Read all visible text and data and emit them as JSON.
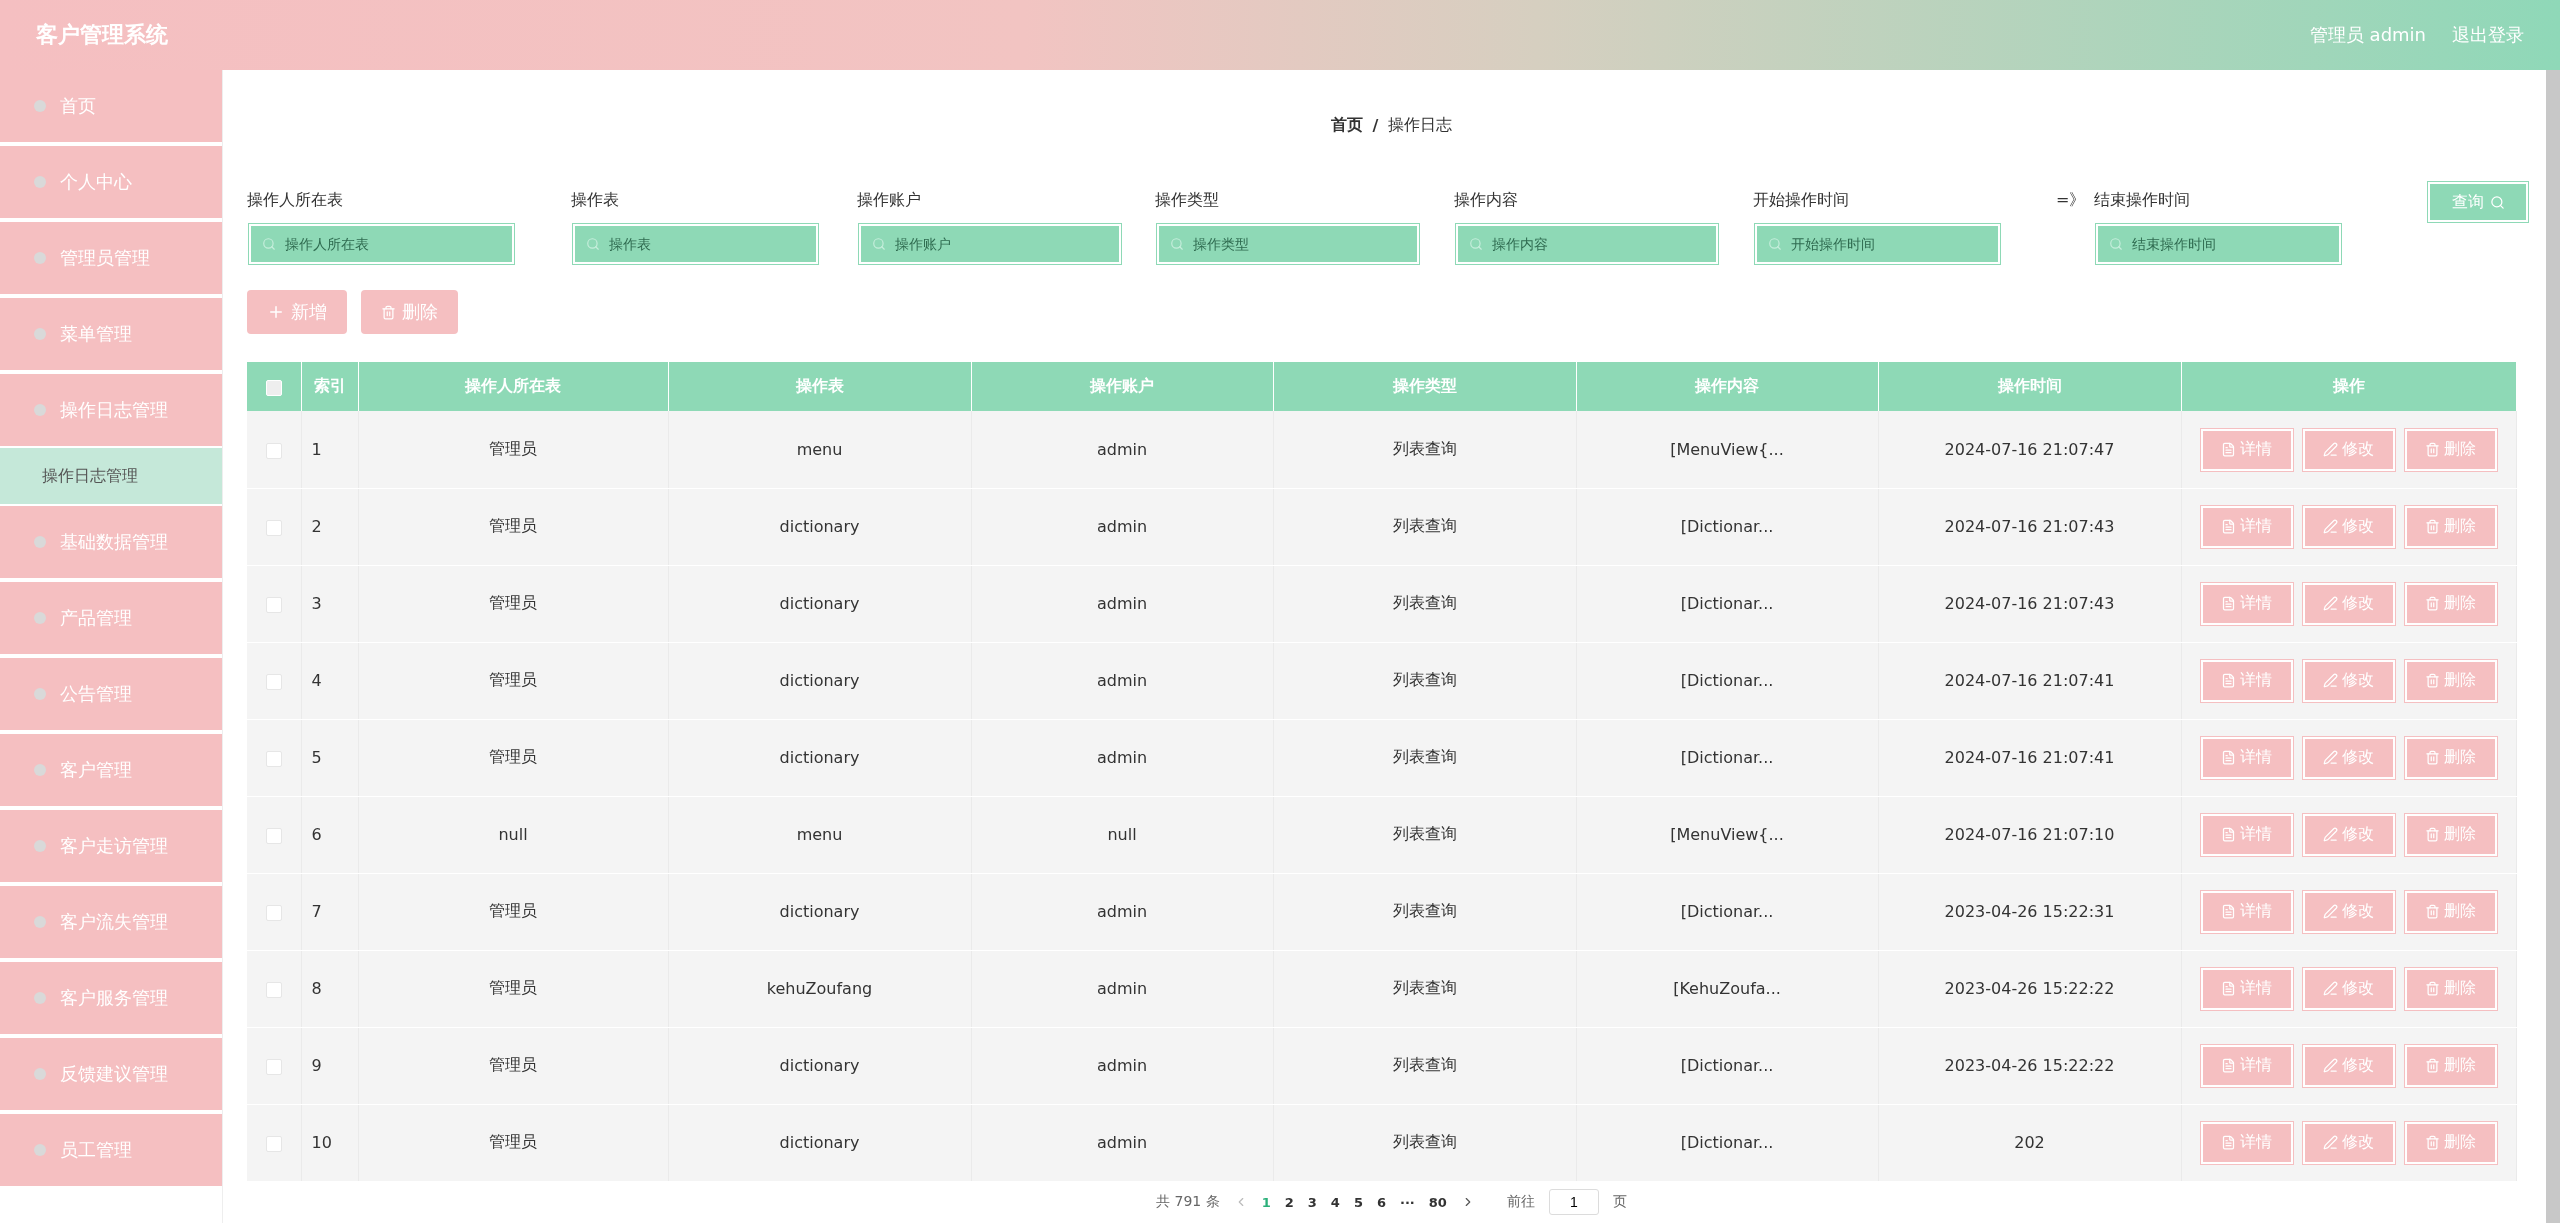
{
  "header": {
    "title": "客户管理系统",
    "user": "管理员 admin",
    "logout": "退出登录"
  },
  "sidebar": {
    "items": [
      {
        "label": "首页"
      },
      {
        "label": "个人中心"
      },
      {
        "label": "管理员管理"
      },
      {
        "label": "菜单管理"
      },
      {
        "label": "操作日志管理",
        "children": [
          {
            "label": "操作日志管理",
            "selected": true
          }
        ]
      },
      {
        "label": "基础数据管理"
      },
      {
        "label": "产品管理"
      },
      {
        "label": "公告管理"
      },
      {
        "label": "客户管理"
      },
      {
        "label": "客户走访管理"
      },
      {
        "label": "客户流失管理"
      },
      {
        "label": "客户服务管理"
      },
      {
        "label": "反馈建议管理"
      },
      {
        "label": "员工管理"
      }
    ]
  },
  "breadcrumb": [
    "首页",
    "操作日志"
  ],
  "breadcrumb_separator": "/",
  "filters": [
    {
      "label": "操作人所在表",
      "placeholder": "操作人所在表"
    },
    {
      "label": "操作表",
      "placeholder": "操作表"
    },
    {
      "label": "操作账户",
      "placeholder": "操作账户"
    },
    {
      "label": "操作类型",
      "placeholder": "操作类型"
    },
    {
      "label": "操作内容",
      "placeholder": "操作内容"
    },
    {
      "label": "开始操作时间",
      "placeholder": "开始操作时间"
    }
  ],
  "range_separator": "=》",
  "end_filter": {
    "label": "结束操作时间",
    "placeholder": "结束操作时间"
  },
  "query_button": "查询",
  "toolbar": [
    {
      "label": "新增",
      "kind": "add"
    },
    {
      "label": "删除",
      "kind": "delete"
    }
  ],
  "table": {
    "header_checked": false,
    "columns": [
      "索引",
      "操作人所在表",
      "操作表",
      "操作账户",
      "操作类型",
      "操作内容",
      "操作时间",
      "操作"
    ],
    "rows": [
      {
        "checked": false,
        "cells": [
          "1",
          "管理员",
          "menu",
          "admin",
          "列表查询",
          "[MenuView{...",
          "2024-07-16 21:07:47"
        ],
        "actions": [
          {
            "label": "详情",
            "kind": "detail"
          },
          {
            "label": "修改",
            "kind": "edit"
          },
          {
            "label": "删除",
            "kind": "delete"
          }
        ]
      },
      {
        "checked": false,
        "cells": [
          "2",
          "管理员",
          "dictionary",
          "admin",
          "列表查询",
          "[Dictionar...",
          "2024-07-16 21:07:43"
        ],
        "actions": [
          {
            "label": "详情",
            "kind": "detail"
          },
          {
            "label": "修改",
            "kind": "edit"
          },
          {
            "label": "删除",
            "kind": "delete"
          }
        ]
      },
      {
        "checked": false,
        "cells": [
          "3",
          "管理员",
          "dictionary",
          "admin",
          "列表查询",
          "[Dictionar...",
          "2024-07-16 21:07:43"
        ],
        "actions": [
          {
            "label": "详情",
            "kind": "detail"
          },
          {
            "label": "修改",
            "kind": "edit"
          },
          {
            "label": "删除",
            "kind": "delete"
          }
        ]
      },
      {
        "checked": false,
        "cells": [
          "4",
          "管理员",
          "dictionary",
          "admin",
          "列表查询",
          "[Dictionar...",
          "2024-07-16 21:07:41"
        ],
        "actions": [
          {
            "label": "详情",
            "kind": "detail"
          },
          {
            "label": "修改",
            "kind": "edit"
          },
          {
            "label": "删除",
            "kind": "delete"
          }
        ]
      },
      {
        "checked": false,
        "cells": [
          "5",
          "管理员",
          "dictionary",
          "admin",
          "列表查询",
          "[Dictionar...",
          "2024-07-16 21:07:41"
        ],
        "actions": [
          {
            "label": "详情",
            "kind": "detail"
          },
          {
            "label": "修改",
            "kind": "edit"
          },
          {
            "label": "删除",
            "kind": "delete"
          }
        ]
      },
      {
        "checked": false,
        "cells": [
          "6",
          "null",
          "menu",
          "null",
          "列表查询",
          "[MenuView{...",
          "2024-07-16 21:07:10"
        ],
        "actions": [
          {
            "label": "详情",
            "kind": "detail"
          },
          {
            "label": "修改",
            "kind": "edit"
          },
          {
            "label": "删除",
            "kind": "delete"
          }
        ]
      },
      {
        "checked": false,
        "cells": [
          "7",
          "管理员",
          "dictionary",
          "admin",
          "列表查询",
          "[Dictionar...",
          "2023-04-26 15:22:31"
        ],
        "actions": [
          {
            "label": "详情",
            "kind": "detail"
          },
          {
            "label": "修改",
            "kind": "edit"
          },
          {
            "label": "删除",
            "kind": "delete"
          }
        ]
      },
      {
        "checked": false,
        "cells": [
          "8",
          "管理员",
          "kehuZoufang",
          "admin",
          "列表查询",
          "[KehuZoufa...",
          "2023-04-26 15:22:22"
        ],
        "actions": [
          {
            "label": "详情",
            "kind": "detail"
          },
          {
            "label": "修改",
            "kind": "edit"
          },
          {
            "label": "删除",
            "kind": "delete"
          }
        ]
      },
      {
        "checked": false,
        "cells": [
          "9",
          "管理员",
          "dictionary",
          "admin",
          "列表查询",
          "[Dictionar...",
          "2023-04-26 15:22:22"
        ],
        "actions": [
          {
            "label": "详情",
            "kind": "detail"
          },
          {
            "label": "修改",
            "kind": "edit"
          },
          {
            "label": "删除",
            "kind": "delete"
          }
        ]
      },
      {
        "checked": false,
        "cells": [
          "10",
          "管理员",
          "dictionary",
          "admin",
          "列表查询",
          "[Dictionar...",
          "202"
        ],
        "actions": [
          {
            "label": "详情",
            "kind": "detail"
          },
          {
            "label": "修改",
            "kind": "edit"
          },
          {
            "label": "删除",
            "kind": "delete"
          }
        ]
      }
    ]
  },
  "pagination": {
    "total": "共 791 条",
    "pages": [
      {
        "label": "1",
        "selected": true
      },
      {
        "label": "2",
        "selected": false
      },
      {
        "label": "3",
        "selected": false
      },
      {
        "label": "4",
        "selected": false
      },
      {
        "label": "5",
        "selected": false
      },
      {
        "label": "6",
        "selected": false
      },
      {
        "label": "···",
        "selected": false
      },
      {
        "label": "80",
        "selected": false
      }
    ],
    "goto": "前往",
    "goto_value": "1",
    "page_unit": "页"
  }
}
